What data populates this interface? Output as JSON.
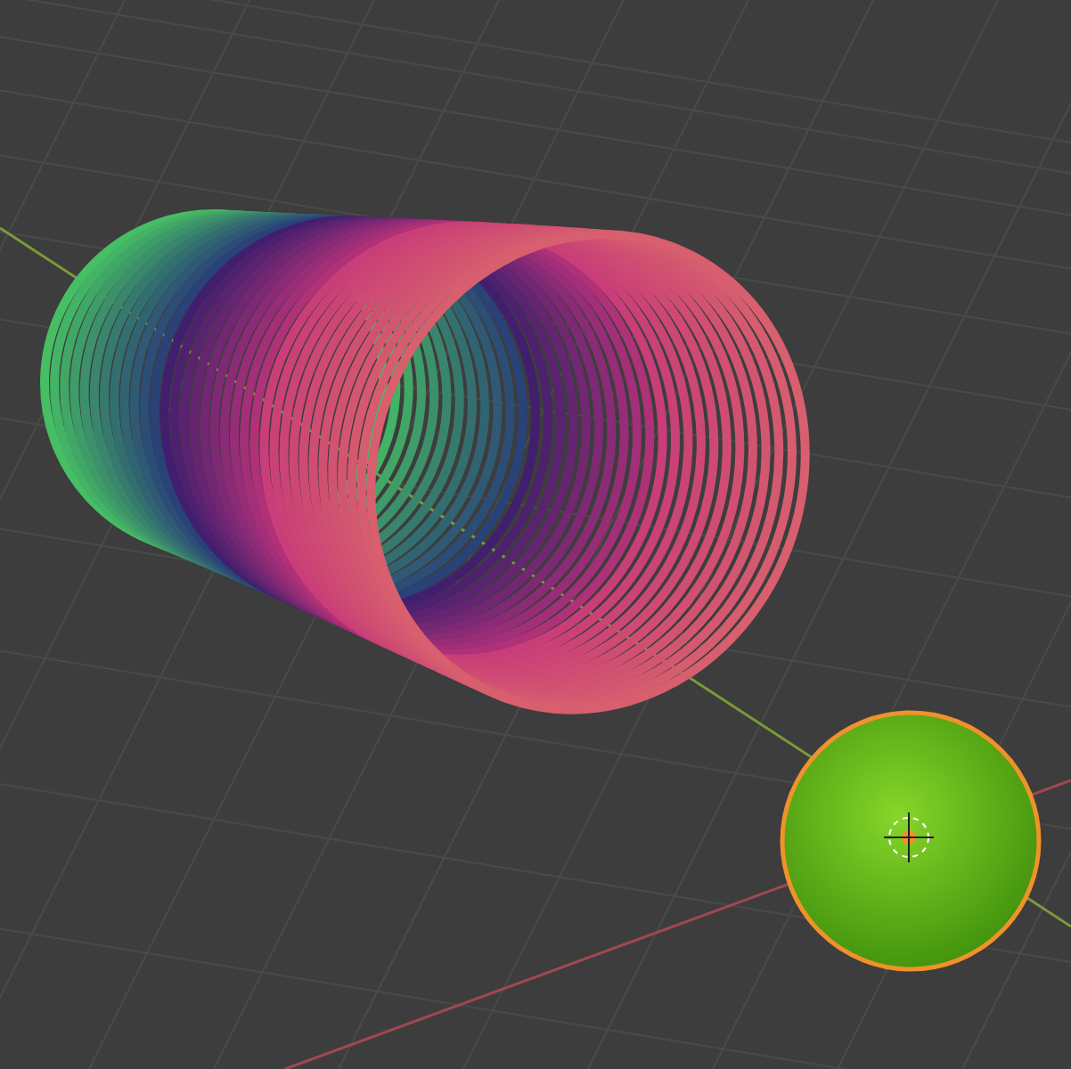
{
  "viewport": {
    "objects": [
      {
        "kind": "ribbon",
        "selected": false
      },
      {
        "kind": "sphere",
        "selected": true
      }
    ]
  }
}
